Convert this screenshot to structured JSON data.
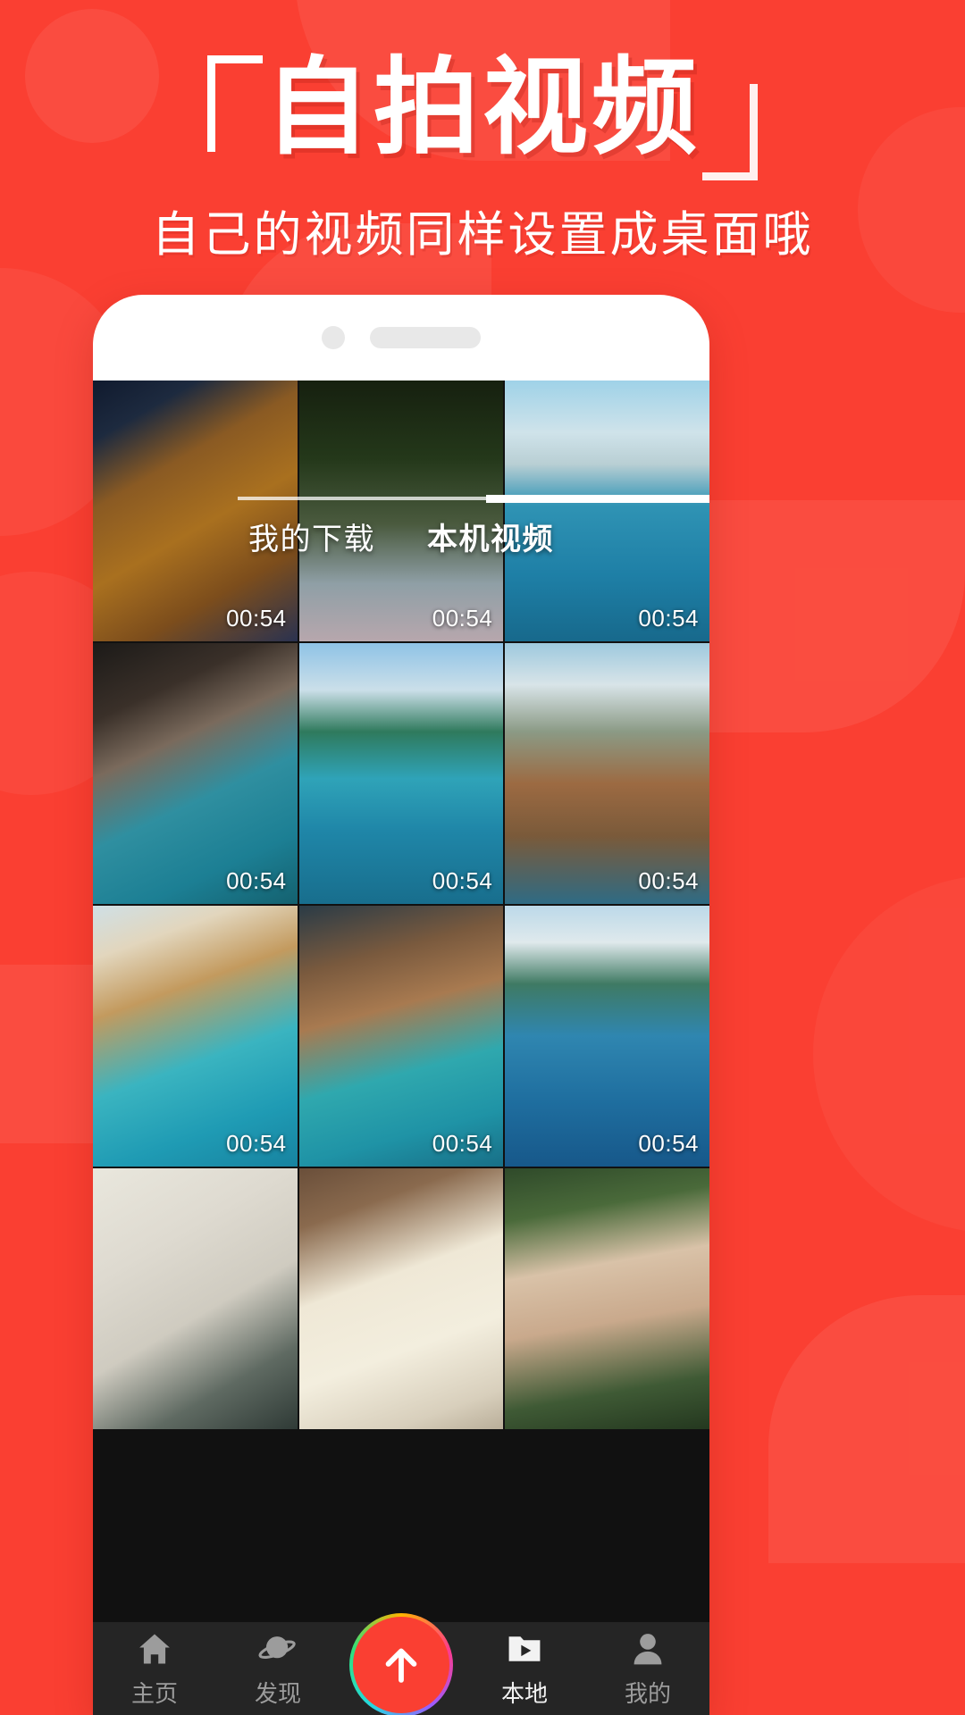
{
  "theme": {
    "brand_red": "#fa3f32",
    "nav_bg": "#252525",
    "active_text": "#ffffff",
    "inactive_text": "#9c9c9c"
  },
  "header": {
    "title": "自拍视频",
    "subtitle": "自己的视频同样设置成桌面哦",
    "bracket_open": "「",
    "bracket_close": "」"
  },
  "phone": {
    "camera_icon": "camera-dot-icon",
    "speaker_icon": "speaker-grille-icon"
  },
  "tabs": [
    {
      "label": "我的下载",
      "active": false
    },
    {
      "label": "本机视频",
      "active": true
    }
  ],
  "grid": {
    "duration_default": "00:54",
    "items": [
      {
        "duration": "00:54",
        "scene": "wooden-table-bowls"
      },
      {
        "duration": "00:54",
        "scene": "street-mural-girl"
      },
      {
        "duration": "00:54",
        "scene": "beach-umbrellas-pier"
      },
      {
        "duration": "00:54",
        "scene": "woman-hair-flip-water"
      },
      {
        "duration": "00:54",
        "scene": "tropical-coastline"
      },
      {
        "duration": "00:54",
        "scene": "aerial-island-town"
      },
      {
        "duration": "00:54",
        "scene": "dog-swimming"
      },
      {
        "duration": "00:54",
        "scene": "underwater-swimmer"
      },
      {
        "duration": "00:54",
        "scene": "woman-jumping-into-sea"
      },
      {
        "duration": "",
        "scene": "surfboard-deck"
      },
      {
        "duration": "",
        "scene": "surfboard-nose-sand"
      },
      {
        "duration": "",
        "scene": "woman-white-bikini-jungle"
      }
    ]
  },
  "bottom_nav": {
    "items": [
      {
        "label": "主页",
        "icon": "home-icon",
        "active": false
      },
      {
        "label": "发现",
        "icon": "planet-icon",
        "active": false
      },
      {
        "label": "本地",
        "icon": "folder-play-icon",
        "active": true
      },
      {
        "label": "我的",
        "icon": "person-icon",
        "active": false
      }
    ],
    "upload_button": {
      "icon": "arrow-up-icon",
      "label": ""
    }
  }
}
